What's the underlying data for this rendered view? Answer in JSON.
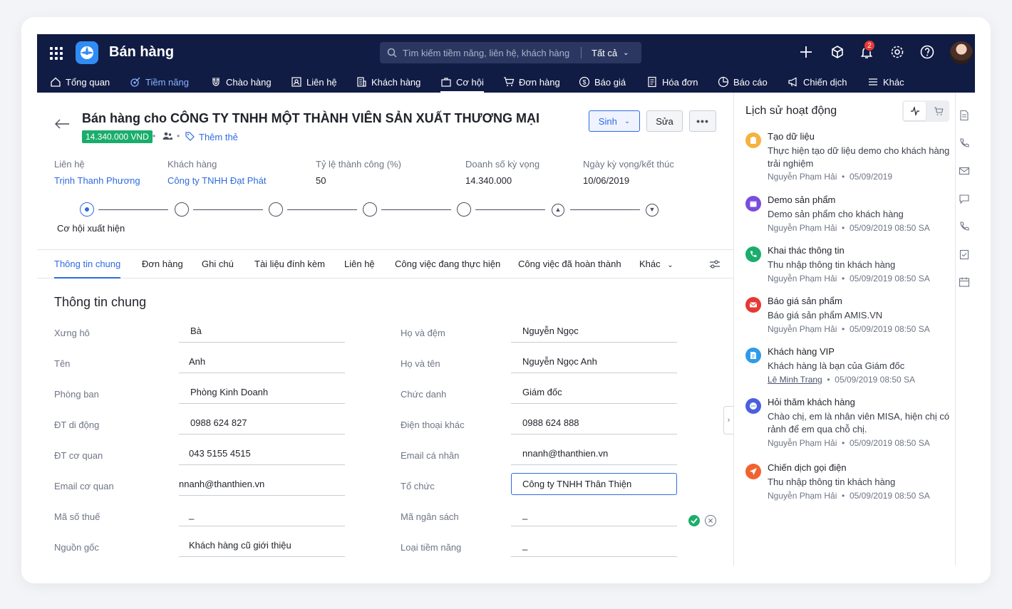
{
  "app": {
    "title": "Bán hàng"
  },
  "search": {
    "placeholder": "Tìm kiếm tiềm năng, liên hệ, khách hàng",
    "scope": "Tất cả"
  },
  "notifications": {
    "count": "2"
  },
  "nav": [
    {
      "label": "Tổng quan",
      "icon": "home-icon"
    },
    {
      "label": "Tiềm năng",
      "icon": "target-icon"
    },
    {
      "label": "Chào hàng",
      "icon": "magnet-icon"
    },
    {
      "label": "Liên hệ",
      "icon": "contact-card-icon"
    },
    {
      "label": "Khách hàng",
      "icon": "building-icon"
    },
    {
      "label": "Cơ hội",
      "icon": "briefcase-icon"
    },
    {
      "label": "Đơn hàng",
      "icon": "cart-icon"
    },
    {
      "label": "Báo giá",
      "icon": "dollar-icon"
    },
    {
      "label": "Hóa đơn",
      "icon": "invoice-icon"
    },
    {
      "label": "Báo cáo",
      "icon": "pie-chart-icon"
    },
    {
      "label": "Chiến dịch",
      "icon": "megaphone-icon"
    },
    {
      "label": "Khác",
      "icon": "menu-icon"
    }
  ],
  "record": {
    "title": "Bán hàng cho CÔNG TY TNHH MỘT THÀNH VIÊN SẢN XUẤT THƯƠNG MẠI",
    "amount": "14.340.000 VND",
    "add_tag": "Thêm thẻ",
    "actions": {
      "generate": "Sinh",
      "edit": "Sửa",
      "more": "•••"
    }
  },
  "summary": [
    {
      "label": "Liên hệ",
      "value": "Trịnh Thanh Phương",
      "link": true
    },
    {
      "label": "Khách hàng",
      "value": "Công ty TNHH Đạt Phát",
      "link": true
    },
    {
      "label": "Tỷ lệ thành công (%)",
      "value": "50",
      "link": false
    },
    {
      "label": "Doanh số kỳ vọng",
      "value": "14.340.000",
      "link": false
    },
    {
      "label": "Ngày kỳ vọng/kết thúc",
      "value": "10/06/2019",
      "link": false
    }
  ],
  "pipeline": {
    "current_stage": "Cơ hội xuất hiện",
    "stage_count": 7,
    "current_index": 0
  },
  "tabs": [
    "Thông tin chung",
    "Đơn hàng",
    "Ghi chú",
    "Tài liệu đính kèm",
    "Liên hệ",
    "Công việc đang thực hiện",
    "Công việc đã hoàn thành",
    "Khác"
  ],
  "general": {
    "title": "Thông tin chung",
    "left_fields": [
      {
        "label": "Xưng hô",
        "value": "Bà"
      },
      {
        "label": "Tên",
        "value": "Anh"
      },
      {
        "label": "Phòng ban",
        "value": "Phòng Kinh Doanh"
      },
      {
        "label": "ĐT di động",
        "value": "0988 624 827"
      },
      {
        "label": "ĐT cơ quan",
        "value": "043 5155 4515"
      },
      {
        "label": "Email cơ quan",
        "value": "nnanh@thanthien.vn"
      },
      {
        "label": "Mã số thuế",
        "value": "_"
      },
      {
        "label": "Nguồn gốc",
        "value": "Khách hàng cũ giới thiệu"
      }
    ],
    "right_fields": [
      {
        "label": "Họ và đệm",
        "value": "Nguyễn Ngọc"
      },
      {
        "label": "Họ và tên",
        "value": "Nguyễn Ngọc Anh"
      },
      {
        "label": "Chức danh",
        "value": "Giám đốc"
      },
      {
        "label": "Điện thoại khác",
        "value": "0988 624 888"
      },
      {
        "label": "Email cá nhân",
        "value": "nnanh@thanthien.vn"
      },
      {
        "label": "Tổ chức",
        "value": "Công ty TNHH Thân Thiện"
      },
      {
        "label": "Mã ngân sách",
        "value": "_"
      },
      {
        "label": "Loại tiềm năng",
        "value": "_"
      }
    ]
  },
  "activity": {
    "title": "Lịch sử hoạt động",
    "items": [
      {
        "title": "Tạo dữ liệu",
        "desc": "Thực hiện tạo dữ liệu demo cho khách hàng trải nghiệm",
        "user": "Nguyễn Phạm Hải",
        "time": "05/09/2019",
        "color": "#f5b23d",
        "icon": "clipboard-icon"
      },
      {
        "title": "Demo sản phẩm",
        "desc": "Demo sản phẩm cho khách hàng",
        "user": "Nguyễn Phạm Hải",
        "time": "05/09/2019 08:50 SA",
        "color": "#7a4cdc",
        "icon": "calendar-icon"
      },
      {
        "title": "Khai thác thông tin",
        "desc": "Thu nhập thông tin khách hàng",
        "user": "Nguyễn Phạm Hải",
        "time": "05/09/2019 08:50 SA",
        "color": "#1aad6b",
        "icon": "phone-icon"
      },
      {
        "title": "Báo giá sản phẩm",
        "desc": "Báo giá sản phẩm AMIS.VN",
        "user": "Nguyễn Phạm Hải",
        "time": "05/09/2019 08:50 SA",
        "color": "#e53935",
        "icon": "mail-icon"
      },
      {
        "title": "Khách hàng VIP",
        "desc": "Khách hàng là bạn của Giám đốc",
        "user": "Lê Minh Trang",
        "time": "05/09/2019 08:50 SA",
        "color": "#2f9be8",
        "icon": "note-icon"
      },
      {
        "title": "Hỏi thăm khách hàng",
        "desc": "Chào chị, em là nhân viên MISA, hiện chị có rảnh để em qua chỗ chị.",
        "user": "Nguyễn Phạm Hải",
        "time": "05/09/2019 08:50 SA",
        "color": "#4b5fe0",
        "icon": "chat-icon"
      },
      {
        "title": "Chiến dịch gọi điện",
        "desc": "Thu nhập thông tin khách hàng",
        "user": "Nguyễn Phạm Hải",
        "time": "05/09/2019 08:50 SA",
        "color": "#f2622e",
        "icon": "send-icon"
      }
    ]
  },
  "colors": {
    "topbar": "#111c45",
    "accent": "#2e6bdf",
    "success": "#1aad6b"
  }
}
